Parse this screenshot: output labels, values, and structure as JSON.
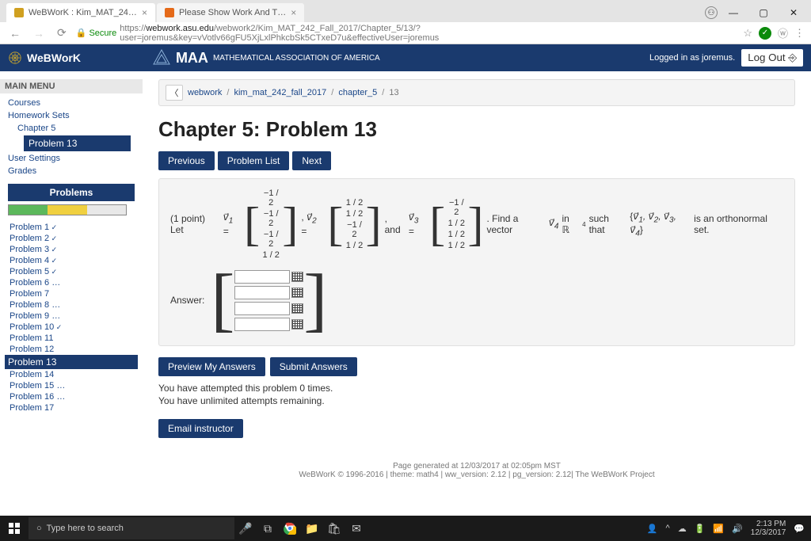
{
  "browser": {
    "tabs": [
      {
        "title": "WeBWorK : Kim_MAT_24…",
        "active": true
      },
      {
        "title": "Please Show Work And T…",
        "active": false
      }
    ],
    "url_secure": "Secure",
    "url_prefix": "https://",
    "url_domain": "webwork.asu.edu",
    "url_path": "/webwork2/Kim_MAT_242_Fall_2017/Chapter_5/13/?user=joremus&key=vVotlv66gFU5XjLxlPhkcbSk5CTxeD7u&effectiveUser=joremus"
  },
  "header": {
    "app": "WeBWorK",
    "maa_text": "MATHEMATICAL ASSOCIATION OF AMERICA",
    "maa_brand": "MAA",
    "login": "Logged in as joremus.",
    "logout": "Log Out ⎆"
  },
  "sidebar": {
    "main_menu": "MAIN MENU",
    "courses": "Courses",
    "hw_sets": "Homework Sets",
    "chapter": "Chapter 5",
    "current_prob": "Problem 13",
    "user_settings": "User Settings",
    "grades": "Grades",
    "problems_hdr": "Problems",
    "list": [
      {
        "label": "Problem 1",
        "status": "done"
      },
      {
        "label": "Problem 2",
        "status": "done"
      },
      {
        "label": "Problem 3",
        "status": "done"
      },
      {
        "label": "Problem 4",
        "status": "done"
      },
      {
        "label": "Problem 5",
        "status": "done"
      },
      {
        "label": "Problem 6",
        "status": "dots"
      },
      {
        "label": "Problem 7",
        "status": ""
      },
      {
        "label": "Problem 8",
        "status": "dots"
      },
      {
        "label": "Problem 9",
        "status": "dots"
      },
      {
        "label": "Problem 10",
        "status": "done"
      },
      {
        "label": "Problem 11",
        "status": ""
      },
      {
        "label": "Problem 12",
        "status": ""
      },
      {
        "label": "Problem 13",
        "status": "current"
      },
      {
        "label": "Problem 14",
        "status": ""
      },
      {
        "label": "Problem 15",
        "status": "dots"
      },
      {
        "label": "Problem 16",
        "status": "dots"
      },
      {
        "label": "Problem 17",
        "status": ""
      }
    ]
  },
  "breadcrumb": {
    "items": [
      "webwork",
      "kim_mat_242_fall_2017",
      "chapter_5"
    ],
    "current": "13"
  },
  "page": {
    "title": "Chapter 5: Problem 13",
    "prev": "Previous",
    "list": "Problem List",
    "next": "Next",
    "points": "(1 point) Let",
    "and": ", and",
    "find_a": ". Find a vector",
    "find_b": "in ℝ",
    "find_c": "such that",
    "find_d": "is an orthonormal set.",
    "v1": [
      "−1 / 2",
      "−1 / 2",
      "−1 / 2",
      "1 / 2"
    ],
    "v2": [
      "1 / 2",
      "1 / 2",
      "−1 / 2",
      "1 / 2"
    ],
    "v3": [
      "−1 / 2",
      "1 / 2",
      "1 / 2",
      "1 / 2"
    ],
    "answer_label": "Answer:",
    "preview": "Preview My Answers",
    "submit": "Submit Answers",
    "attempt1": "You have attempted this problem 0 times.",
    "attempt2": "You have unlimited attempts remaining.",
    "email": "Email instructor"
  },
  "footer": {
    "line1": "Page generated at 12/03/2017 at 02:05pm MST",
    "line2": "WeBWorK © 1996-2016 | theme: math4 | ww_version: 2.12 | pg_version: 2.12| The WeBWorK Project"
  },
  "taskbar": {
    "search": "Type here to search",
    "time": "2:13 PM",
    "date": "12/3/2017"
  }
}
